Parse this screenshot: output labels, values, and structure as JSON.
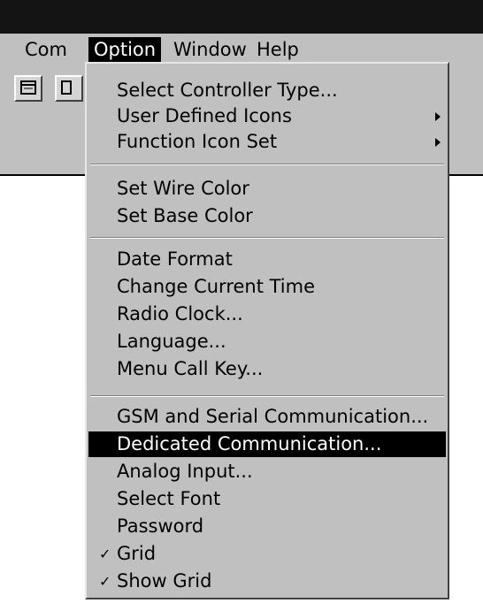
{
  "menubar": {
    "items": [
      {
        "label": "Com"
      },
      {
        "label": "Option"
      },
      {
        "label": "Window"
      },
      {
        "label": "Help"
      }
    ]
  },
  "option_menu": {
    "items": [
      {
        "label": "Select Controller Type..."
      },
      {
        "label": "User Defined Icons",
        "submenu": true
      },
      {
        "label": "Function Icon Set",
        "submenu": true
      },
      {
        "label": "Set Wire Color"
      },
      {
        "label": "Set Base Color"
      },
      {
        "label": "Date Format"
      },
      {
        "label": "Change Current Time"
      },
      {
        "label": "Radio Clock..."
      },
      {
        "label": "Language..."
      },
      {
        "label": "Menu Call Key..."
      },
      {
        "label": "GSM and Serial Communication..."
      },
      {
        "label": "Dedicated Communication...",
        "selected": true
      },
      {
        "label": "Analog Input..."
      },
      {
        "label": "Select Font"
      },
      {
        "label": "Password"
      },
      {
        "label": "Grid",
        "checked": true
      },
      {
        "label": "Show Grid",
        "checked": true
      }
    ]
  },
  "icons": {
    "check": "✓",
    "submenu_arrow": "triangle-right-icon"
  }
}
